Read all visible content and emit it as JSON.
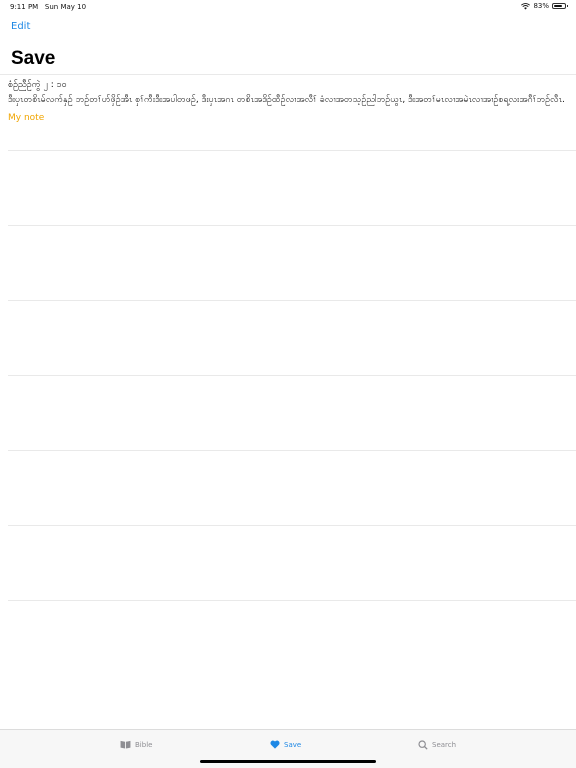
{
  "status_bar": {
    "time": "9:11 PM",
    "date": "Sun May 10",
    "battery": "83%",
    "battery_level": 0.83
  },
  "nav": {
    "edit_label": "Edit",
    "title": "Save"
  },
  "saved_verses": [
    {
      "reference": "စံဉ်ညီဉ်ကွဲ ၂ : ၁၀",
      "text": "ဒီးပှၤတစိၤမ်လက်နှဉ် ဘဉ်တၢ်ဟ်ဖှိဉ်အီၤ စှၢ်ကီးဒီးအပါတဖဉ်, ဒီးပှၤအဂၤ တစိၤအဒိဉ်ထီဉ်လၢအလီၢ် ခံလၢအတသ့ဉ်ညါဘဉ်ယွၤ, ဒီးအတၢ်မၤလၢအမဲၤလၢအၢဉ်စရ့လးအဂီၢ်ဘဉ်လီၤ.",
      "note": "My note"
    }
  ],
  "tabs": [
    {
      "label": "Bible",
      "icon": "book-icon"
    },
    {
      "label": "Save",
      "icon": "heart-icon"
    },
    {
      "label": "Search",
      "icon": "search-icon"
    }
  ],
  "colors": {
    "accent": "#1e88e5",
    "note": "#f0a500"
  }
}
